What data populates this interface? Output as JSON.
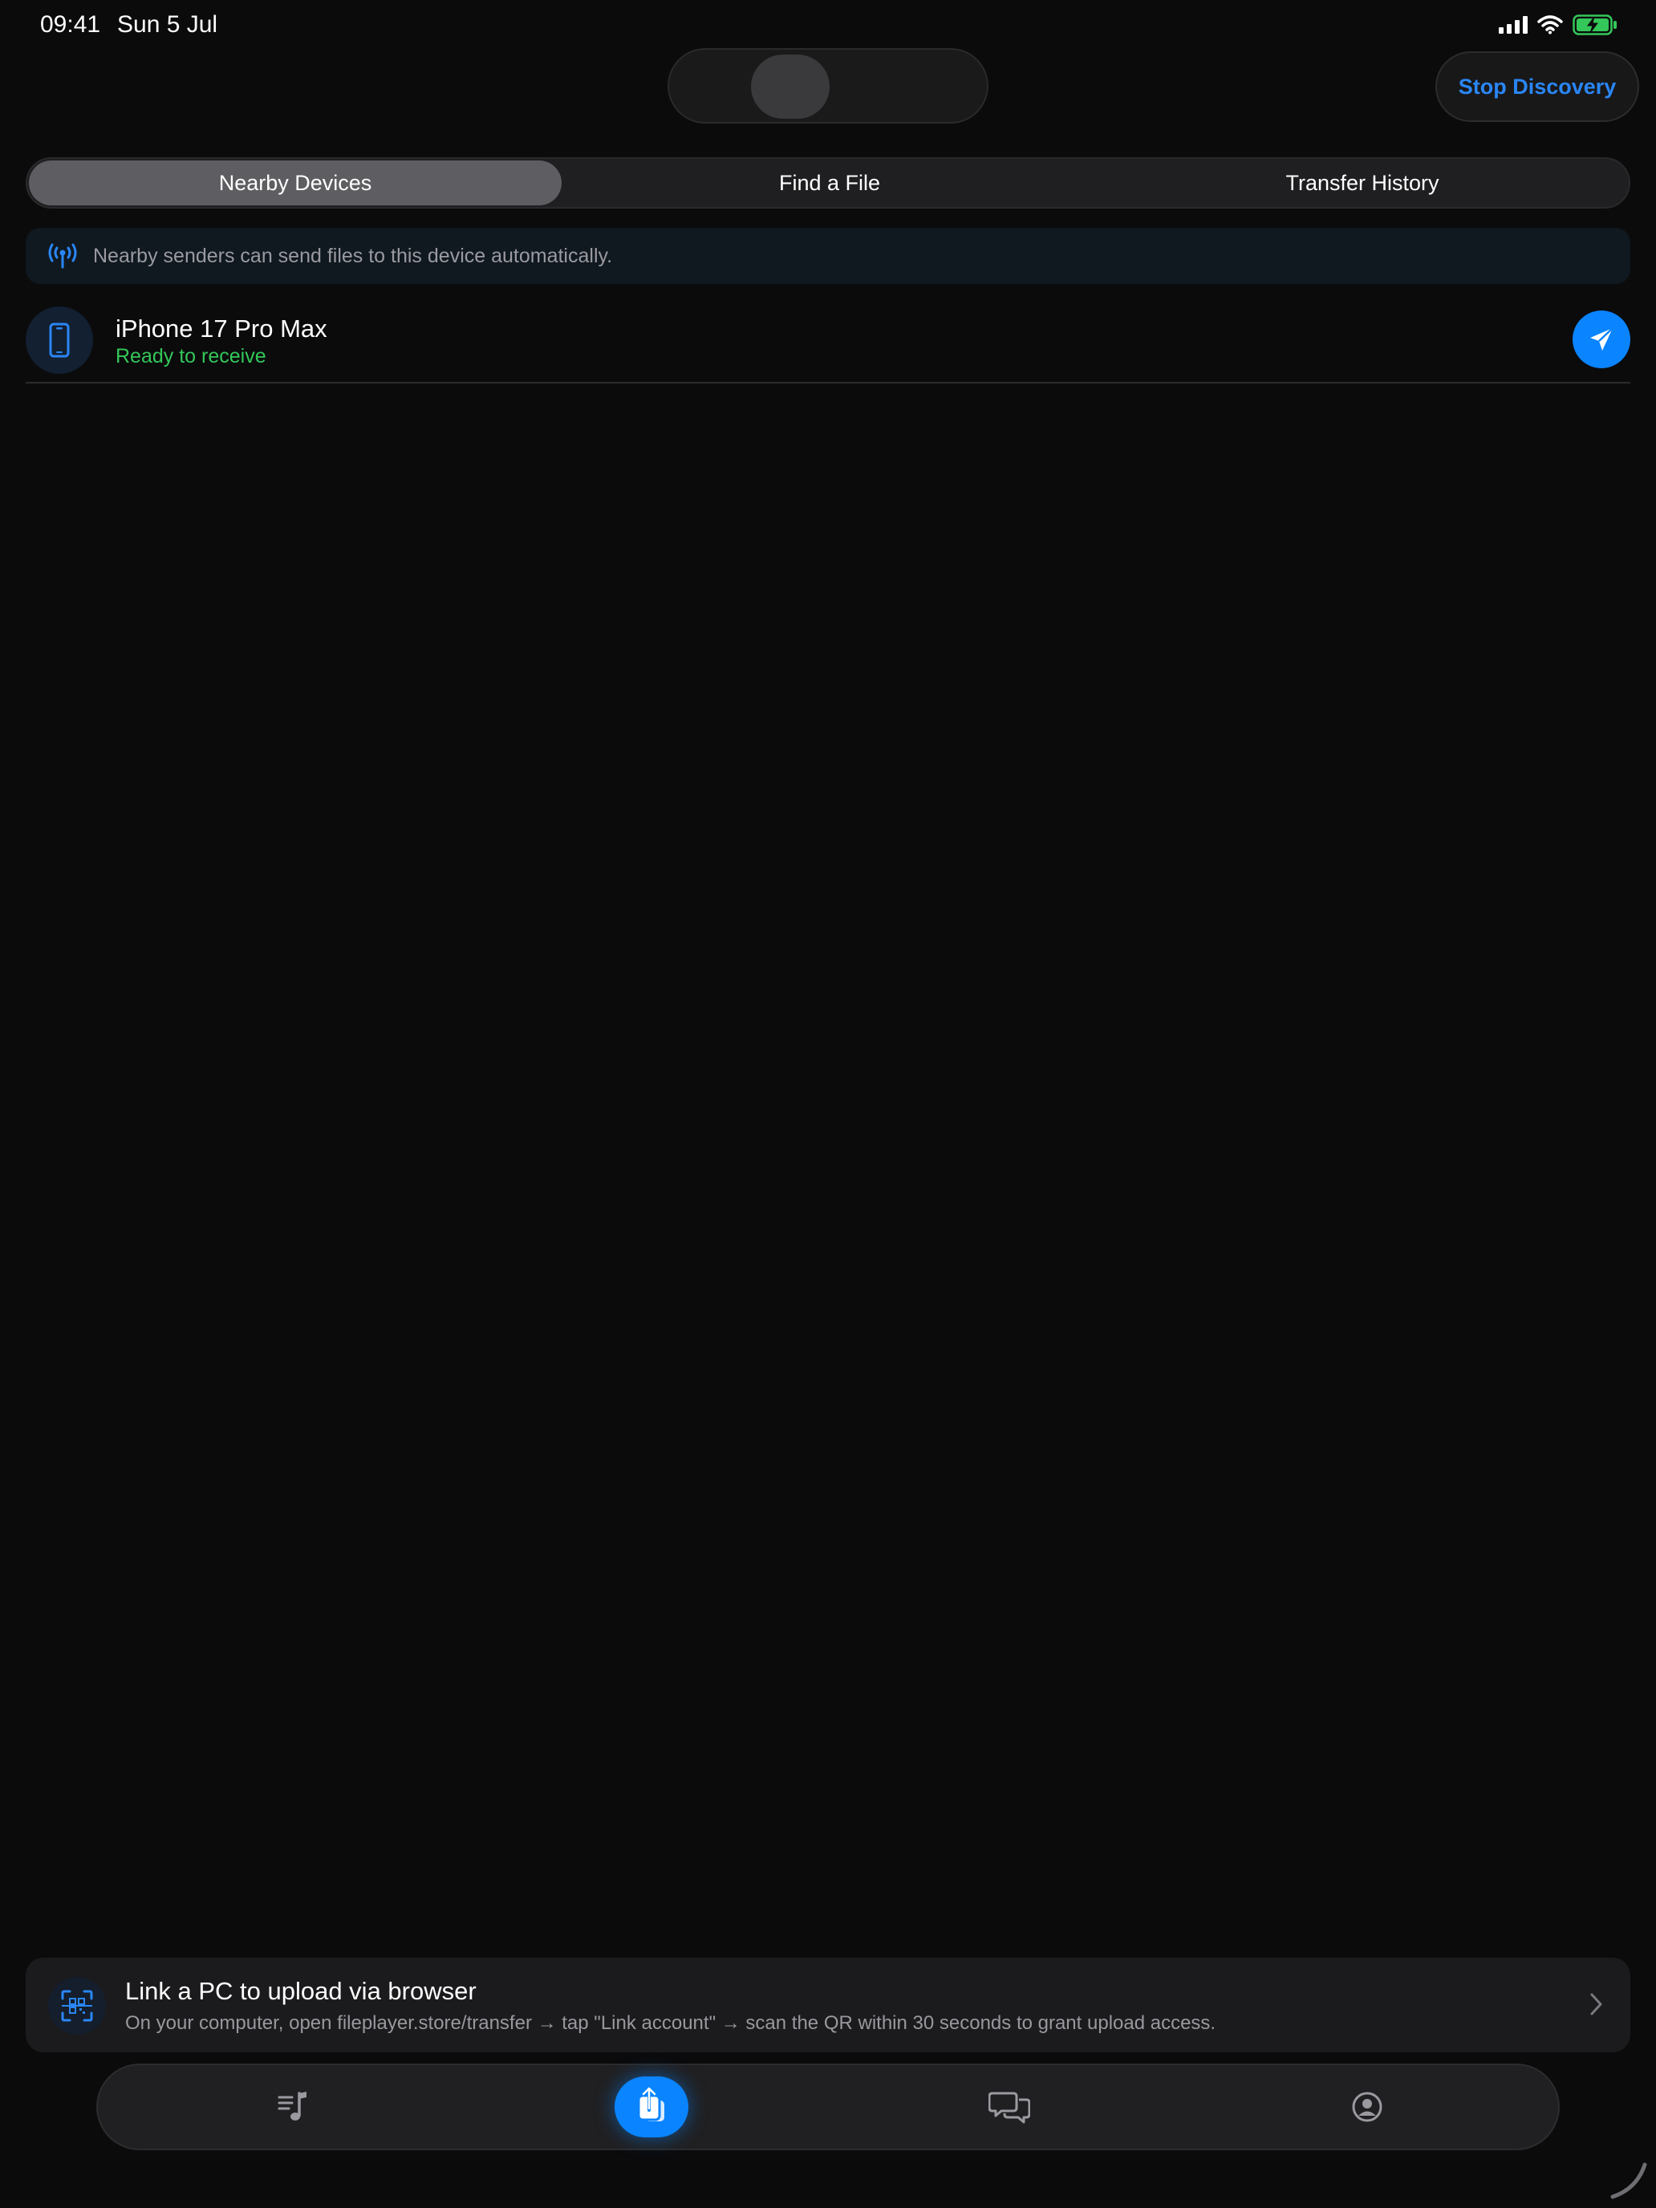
{
  "status_bar": {
    "time": "09:41",
    "date": "Sun 5 Jul",
    "icons": [
      "cellular-signal-icon",
      "wifi-icon",
      "battery-charging-icon"
    ]
  },
  "header": {
    "stop_discovery_label": "Stop Discovery"
  },
  "tabs": [
    {
      "label": "Nearby Devices",
      "active": true
    },
    {
      "label": "Find a File",
      "active": false
    },
    {
      "label": "Transfer History",
      "active": false
    }
  ],
  "info_banner": {
    "icon": "antenna-broadcast-icon",
    "text": "Nearby senders can send files to this device automatically."
  },
  "devices": [
    {
      "name": "iPhone 17 Pro Max",
      "status": "Ready to receive",
      "icon": "iphone-icon",
      "action_icon": "paper-plane-icon"
    }
  ],
  "link_pc": {
    "icon": "qr-scan-icon",
    "title": "Link a PC to upload via browser",
    "description": "On your computer, open fileplayer.store/transfer → tap \"Link account\" → scan the QR within 30 seconds to grant upload access."
  },
  "tab_bar": {
    "items": [
      {
        "icon": "playlist-music-icon",
        "active": false
      },
      {
        "icon": "file-transfer-icon",
        "active": true
      },
      {
        "icon": "chat-bubbles-icon",
        "active": false
      },
      {
        "icon": "profile-icon",
        "active": false
      }
    ]
  },
  "colors": {
    "background": "#0b0b0c",
    "accent": "#0a84ff",
    "accent_text": "#2a86f5",
    "success": "#34c759",
    "secondary_text": "#9a9aa0"
  }
}
